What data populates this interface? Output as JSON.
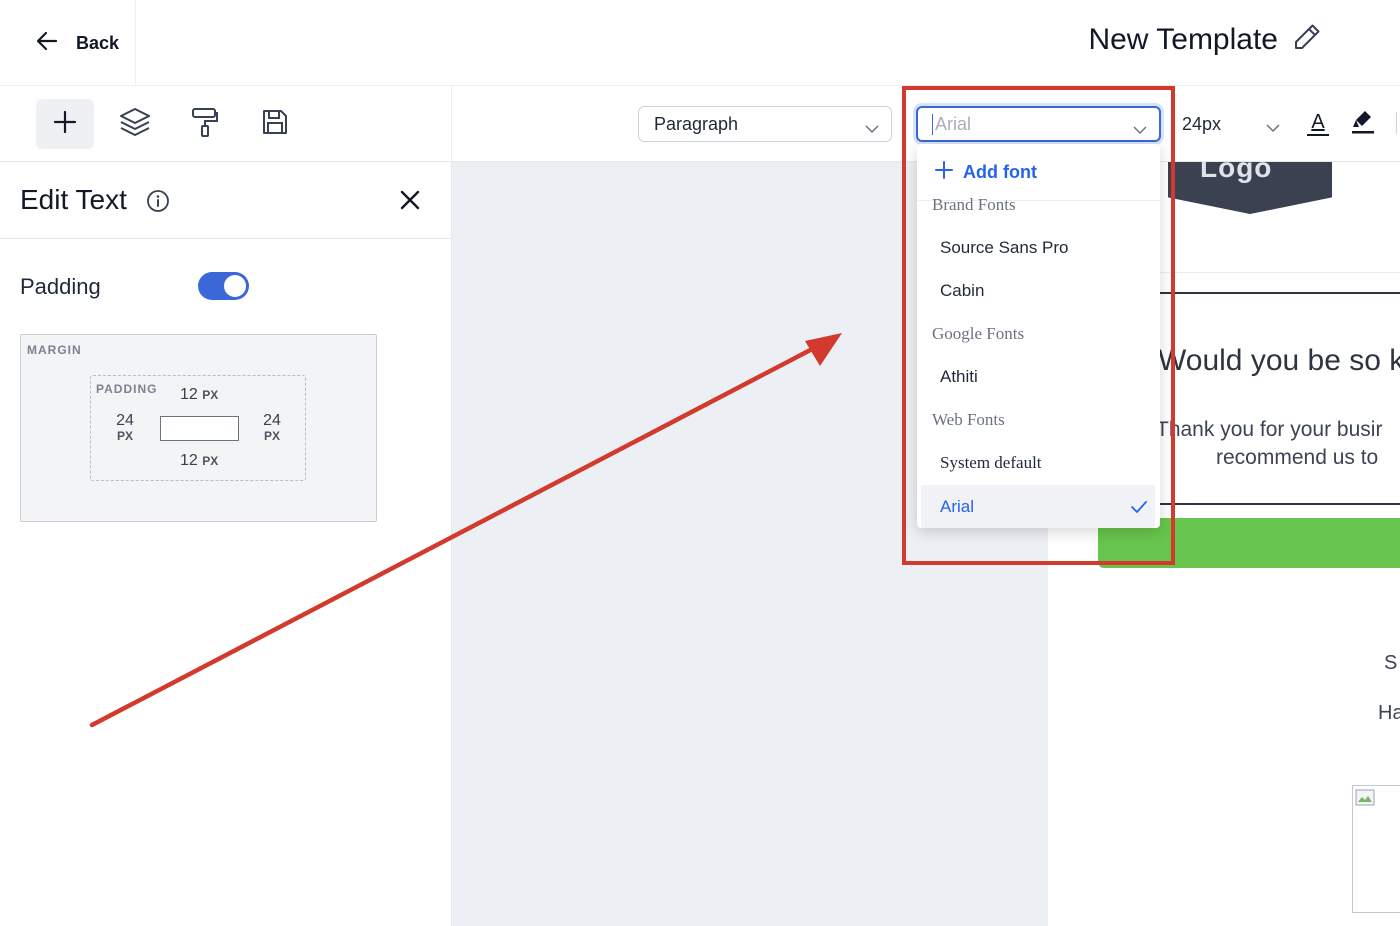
{
  "header": {
    "back_label": "Back",
    "template_title": "New Template"
  },
  "toolbar": {
    "tools": [
      "add-icon",
      "layers-icon",
      "paint-roller-icon",
      "save-icon"
    ],
    "block_type": "Paragraph",
    "font_value": "Arial",
    "font_size": "24px",
    "font_color_glyph": "A"
  },
  "font_dropdown": {
    "add_label": "Add font",
    "groups": [
      {
        "label": "Brand Fonts",
        "options": [
          "Source Sans Pro",
          "Cabin"
        ]
      },
      {
        "label": "Google Fonts",
        "options": [
          "Athiti"
        ]
      },
      {
        "label": "Web Fonts",
        "options": [
          "System default",
          "Arial"
        ]
      }
    ],
    "selected": "Arial"
  },
  "panel": {
    "title": "Edit Text",
    "padding_label": "Padding",
    "padding_enabled": true,
    "margin_label": "MARGIN",
    "padding_box_label": "PADDING",
    "padding": {
      "top": "12",
      "right": "24",
      "bottom": "12",
      "left": "24",
      "unit": "PX"
    }
  },
  "email_preview": {
    "logo_text": "Logo",
    "heading": "Would you be so k",
    "body_line1": "Thank you for your busir",
    "body_line2": "recommend us to",
    "fragment1": "S",
    "fragment2": "Ha"
  },
  "colors": {
    "accent": "#3b68d8",
    "link": "#2563eb",
    "annotation": "#d13a2c",
    "cta": "#67c44c",
    "canvas_bg": "#eceff3"
  }
}
